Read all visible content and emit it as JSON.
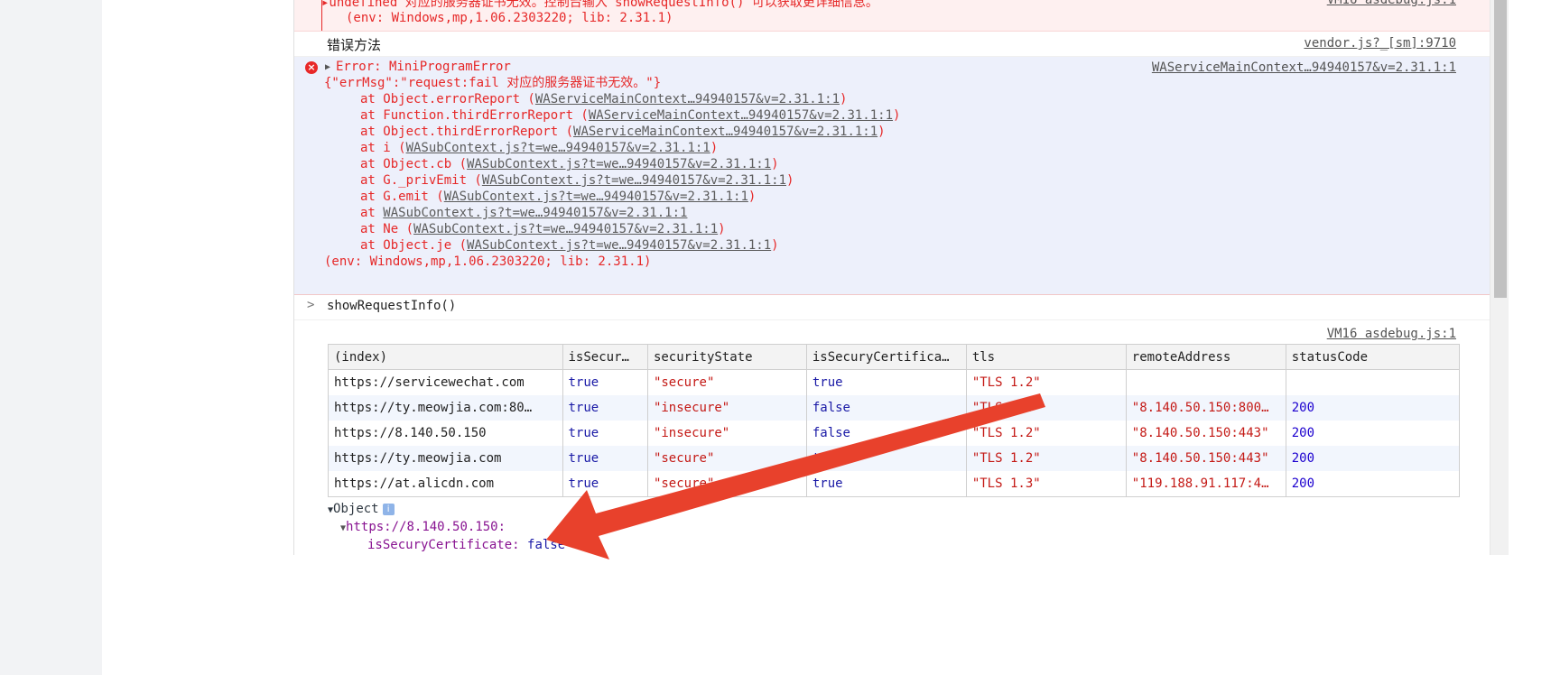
{
  "console": {
    "error_top": {
      "line1": "▸undefined 对应的服务器证书无效。控制台输入 showRequestInfo() 可以获取更详细信息。",
      "line2": "(env: Windows,mp,1.06.2303220; lib: 2.31.1)",
      "source": "VM16 asdebug.js:1"
    },
    "log": {
      "text": "错误方法",
      "source": "vendor.js?_[sm]:9710"
    },
    "error_main": {
      "icon": "×",
      "header": "Error: MiniProgramError",
      "source": "WAServiceMainContext…94940157&v=2.31.1:1",
      "message": "{\"errMsg\":\"request:fail 对应的服务器证书无效。\"}",
      "stack": [
        {
          "prefix": "at Object.errorReport (",
          "link": "WAServiceMainContext…94940157&v=2.31.1:1",
          "suffix": ")"
        },
        {
          "prefix": "at Function.thirdErrorReport (",
          "link": "WAServiceMainContext…94940157&v=2.31.1:1",
          "suffix": ")"
        },
        {
          "prefix": "at Object.thirdErrorReport (",
          "link": "WAServiceMainContext…94940157&v=2.31.1:1",
          "suffix": ")"
        },
        {
          "prefix": "at i (",
          "link": "WASubContext.js?t=we…94940157&v=2.31.1:1",
          "suffix": ")"
        },
        {
          "prefix": "at Object.cb (",
          "link": "WASubContext.js?t=we…94940157&v=2.31.1:1",
          "suffix": ")"
        },
        {
          "prefix": "at G._privEmit (",
          "link": "WASubContext.js?t=we…94940157&v=2.31.1:1",
          "suffix": ")"
        },
        {
          "prefix": "at G.emit (",
          "link": "WASubContext.js?t=we…94940157&v=2.31.1:1",
          "suffix": ")"
        },
        {
          "prefix": "at ",
          "link": "WASubContext.js?t=we…94940157&v=2.31.1:1",
          "suffix": ""
        },
        {
          "prefix": "at Ne (",
          "link": "WASubContext.js?t=we…94940157&v=2.31.1:1",
          "suffix": ")"
        },
        {
          "prefix": "at Object.je (",
          "link": "WASubContext.js?t=we…94940157&v=2.31.1:1",
          "suffix": ")"
        }
      ],
      "env": "(env: Windows,mp,1.06.2303220; lib: 2.31.1)"
    },
    "prompt": {
      "caret": ">",
      "command": "showRequestInfo()"
    },
    "table": {
      "source": "VM16 asdebug.js:1",
      "headers": [
        "(index)",
        "isSecur…",
        "securityState",
        "isSecuryCertifica…",
        "tls",
        "remoteAddress",
        "statusCode"
      ],
      "rows": [
        [
          "https://servicewechat.com",
          "true",
          "\"secure\"",
          "true",
          "\"TLS 1.2\"",
          "",
          ""
        ],
        [
          "https://ty.meowjia.com:80…",
          "true",
          "\"insecure\"",
          "false",
          "\"TLS 1.3\"",
          "\"8.140.50.150:800…",
          "200"
        ],
        [
          "https://8.140.50.150",
          "true",
          "\"insecure\"",
          "false",
          "\"TLS 1.2\"",
          "\"8.140.50.150:443\"",
          "200"
        ],
        [
          "https://ty.meowjia.com",
          "true",
          "\"secure\"",
          "true",
          "\"TLS 1.2\"",
          "\"8.140.50.150:443\"",
          "200"
        ],
        [
          "https://at.alicdn.com",
          "true",
          "\"secure\"",
          "true",
          "\"TLS 1.3\"",
          "\"119.188.91.117:4…",
          "200"
        ]
      ]
    },
    "object_tree": {
      "root": "Object",
      "info_icon": "i",
      "child": "https://8.140.50.150:",
      "prop_key": "isSecuryCertificate:",
      "prop_value": "false"
    }
  },
  "colors": {
    "arrow": "#e8412c",
    "error_text": "#e62828",
    "error_bg": "#edf0fb"
  }
}
